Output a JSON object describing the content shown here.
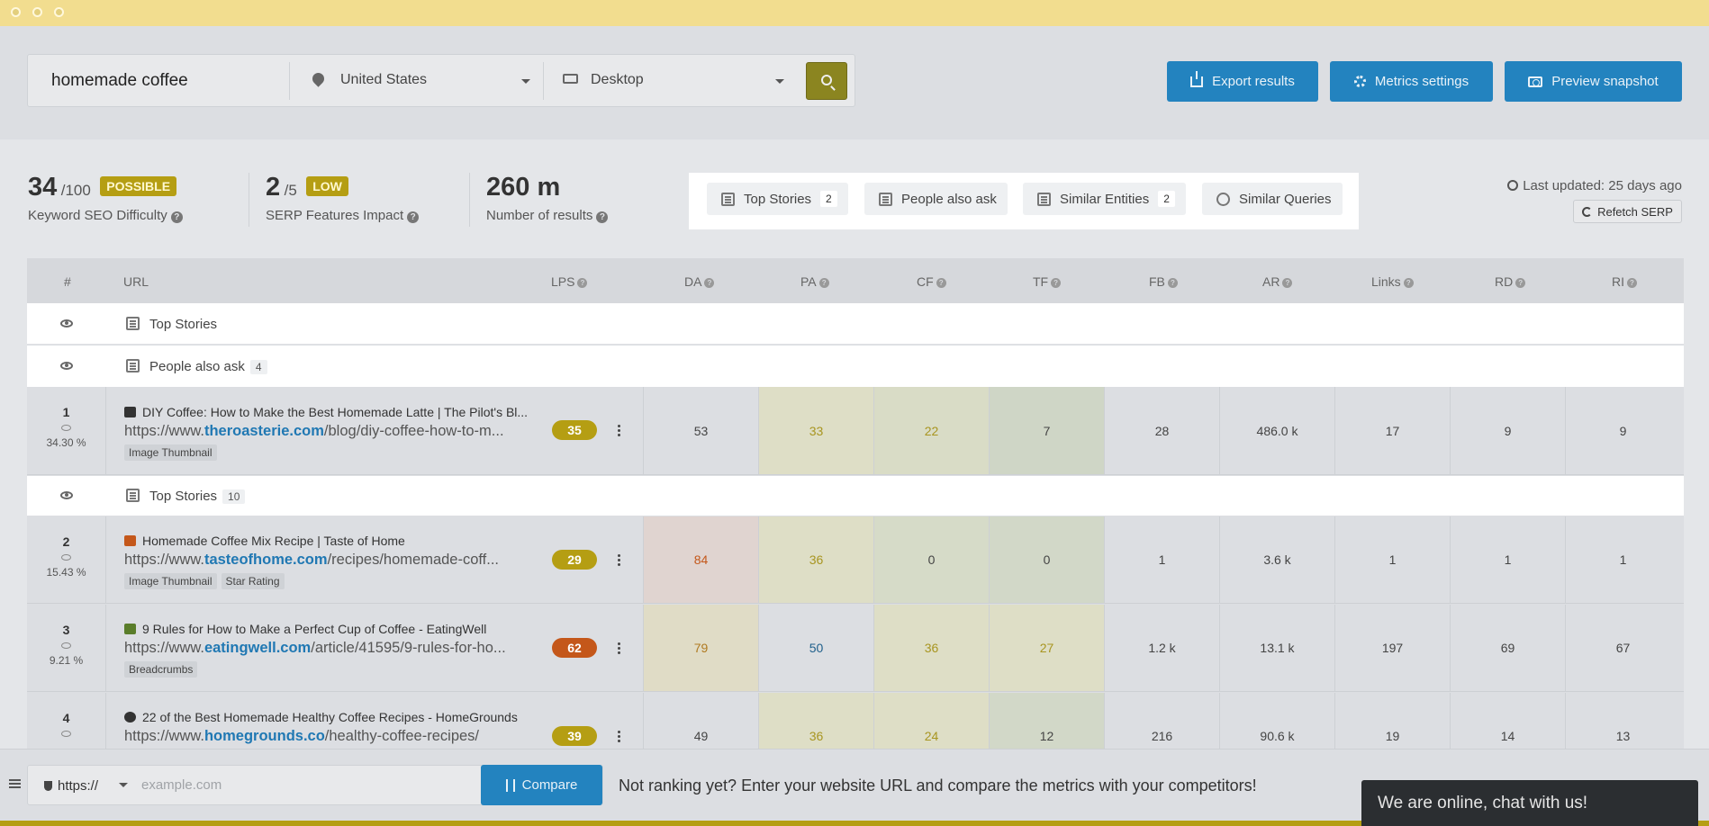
{
  "search": {
    "keyword": "homemade coffee",
    "location": "United States",
    "device": "Desktop"
  },
  "actions": {
    "export": "Export results",
    "metrics": "Metrics settings",
    "preview": "Preview snapshot"
  },
  "metrics": {
    "kd": {
      "value": "34",
      "of": "/100",
      "badge": "POSSIBLE",
      "label": "Keyword SEO Difficulty"
    },
    "sfi": {
      "value": "2",
      "of": "/5",
      "badge": "LOW",
      "label": "SERP Features Impact"
    },
    "results": {
      "value": "260 m",
      "label": "Number of results"
    }
  },
  "features": [
    {
      "label": "Top Stories",
      "count": "2",
      "icon": "top-stories-icon"
    },
    {
      "label": "People also ask",
      "count": "",
      "icon": "people-also-ask-icon"
    },
    {
      "label": "Similar Entities",
      "count": "2",
      "icon": "similar-entities-icon"
    },
    {
      "label": "Similar Queries",
      "count": "",
      "icon": "similar-queries-icon"
    }
  ],
  "last_updated": "Last updated: 25 days ago",
  "refetch": "Refetch SERP",
  "table": {
    "headers": {
      "rank": "#",
      "url": "URL",
      "lps": "LPS",
      "da": "DA",
      "pa": "PA",
      "cf": "CF",
      "tf": "TF",
      "fb": "FB",
      "ar": "AR",
      "links": "Links",
      "rd": "RD",
      "ri": "RI"
    },
    "feature_rows": [
      {
        "label": "Top Stories",
        "count": ""
      },
      {
        "label": "People also ask",
        "count": "4"
      },
      {
        "label": "Top Stories",
        "count": "10"
      }
    ],
    "rows": [
      {
        "rank": "1",
        "pct": "34.30 %",
        "title": "DIY Coffee: How to Make the Best Homemade Latte | The Pilot's Bl...",
        "url_prefix": "https://www.",
        "url_domain": "theroasterie.com",
        "url_path": "/blog/diy-coffee-how-to-m...",
        "tags": [
          "Image Thumbnail"
        ],
        "lps": "35",
        "lps_color": "#b59e13",
        "da": "53",
        "pa": "33",
        "cf": "22",
        "tf": "7",
        "fb": "28",
        "ar": "486.0 k",
        "links": "17",
        "rd": "9",
        "ri": "9"
      },
      {
        "rank": "2",
        "pct": "15.43 %",
        "title": "Homemade Coffee Mix Recipe | Taste of Home",
        "url_prefix": "https://www.",
        "url_domain": "tasteofhome.com",
        "url_path": "/recipes/homemade-coff...",
        "tags": [
          "Image Thumbnail",
          "Star Rating"
        ],
        "lps": "29",
        "lps_color": "#b59e13",
        "da": "84",
        "pa": "36",
        "cf": "0",
        "tf": "0",
        "fb": "1",
        "ar": "3.6 k",
        "links": "1",
        "rd": "1",
        "ri": "1"
      },
      {
        "rank": "3",
        "pct": "9.21 %",
        "title": "9 Rules for How to Make a Perfect Cup of Coffee - EatingWell",
        "url_prefix": "https://www.",
        "url_domain": "eatingwell.com",
        "url_path": "/article/41595/9-rules-for-ho...",
        "tags": [
          "Breadcrumbs"
        ],
        "lps": "62",
        "lps_color": "#c4571a",
        "da": "79",
        "pa": "50",
        "cf": "36",
        "tf": "27",
        "fb": "1.2 k",
        "ar": "13.1 k",
        "links": "197",
        "rd": "69",
        "ri": "67"
      },
      {
        "rank": "4",
        "pct": "",
        "title": "22 of the Best Homemade Healthy Coffee Recipes - HomeGrounds",
        "url_prefix": "https://www.",
        "url_domain": "homegrounds.co",
        "url_path": "/healthy-coffee-recipes/",
        "tags": [],
        "lps": "39",
        "lps_color": "#b59e13",
        "da": "49",
        "pa": "36",
        "cf": "24",
        "tf": "12",
        "fb": "216",
        "ar": "90.6 k",
        "links": "19",
        "rd": "14",
        "ri": "13"
      }
    ]
  },
  "bottom": {
    "protocol": "https://",
    "placeholder": "example.com",
    "compare": "Compare",
    "cta": "Not ranking yet? Enter your website URL and compare the metrics with your competitors!",
    "chat": "We are online, chat with us!"
  }
}
